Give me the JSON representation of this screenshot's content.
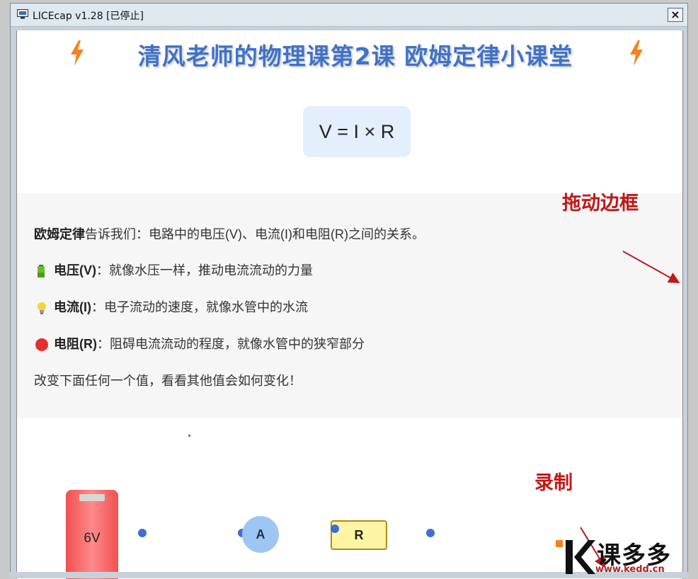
{
  "window": {
    "title": "LICEcap v1.28 [已停止]",
    "close_label": "×"
  },
  "page": {
    "course_title": "清风老师的物理课第2课 欧姆定律小课堂",
    "formula": "V = I × R",
    "intro_bold": "欧姆定律",
    "intro_rest": "告诉我们：电路中的电压(V)、电流(I)和电阻(R)之间的关系。",
    "items": [
      {
        "icon": "battery-icon",
        "label": "电压(V)",
        "desc": "：就像水压一样，推动电流流动的力量"
      },
      {
        "icon": "lightbulb-icon",
        "label": "电流(I)",
        "desc": "：电子流动的速度，就像水管中的水流"
      },
      {
        "icon": "red-circle-icon",
        "label": "电阻(R)",
        "desc": "：阻碍电流流动的程度，就像水管中的狭窄部分"
      }
    ],
    "prompt": "改变下面任何一个值，看看其他值会如何变化！"
  },
  "circuit": {
    "battery_label": "6V",
    "ammeter_label": "A",
    "resistor_label": "R"
  },
  "annotations": {
    "drag_border": "拖动边框",
    "record": "录制"
  },
  "watermark": {
    "brand": "课多多",
    "url": "www.kedd.cn"
  },
  "colors": {
    "title_blue": "#3f72c8",
    "annotation_red": "#c01818",
    "accent_orange": "#f5821f"
  }
}
